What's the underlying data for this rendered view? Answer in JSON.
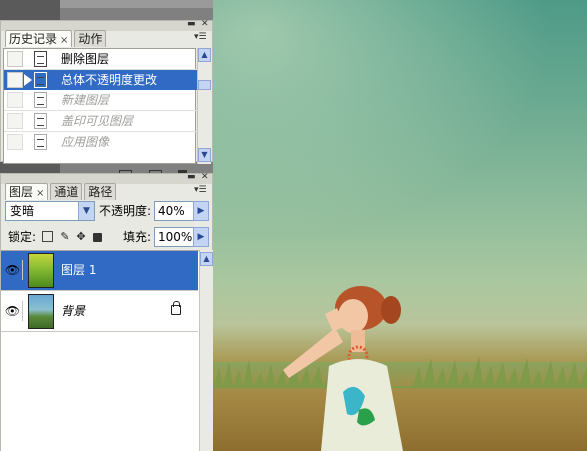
{
  "history_panel": {
    "tabs": [
      {
        "label": "历史记录",
        "close": "×",
        "active": true
      },
      {
        "label": "动作",
        "close": "",
        "active": false
      }
    ],
    "items": [
      {
        "label": "删除图层",
        "state": "normal"
      },
      {
        "label": "总体不透明度更改",
        "state": "selected"
      },
      {
        "label": "新建图层",
        "state": "ghost"
      },
      {
        "label": "盖印可见图层",
        "state": "ghost"
      },
      {
        "label": "应用图像",
        "state": "ghost"
      }
    ],
    "footer_icons": [
      "new-document-from-state-icon",
      "new-snapshot-icon",
      "trash-icon"
    ]
  },
  "layers_panel": {
    "tabs": [
      {
        "label": "图层",
        "close": "×",
        "active": true
      },
      {
        "label": "通道",
        "close": "",
        "active": false
      },
      {
        "label": "路径",
        "close": "",
        "active": false
      }
    ],
    "blend_mode": "变暗",
    "opacity_label": "不透明度:",
    "opacity_value": "40%",
    "lock_label": "锁定:",
    "fill_label": "填充:",
    "fill_value": "100%",
    "layers": [
      {
        "name": "图层 1",
        "selected": true,
        "visible": true,
        "locked": false
      },
      {
        "name": "背景",
        "selected": false,
        "visible": true,
        "locked": true
      }
    ]
  },
  "colors": {
    "selection": "#316ac5",
    "panel_bg": "#e9e9e3",
    "scroll_button": "#c4d4f3"
  }
}
